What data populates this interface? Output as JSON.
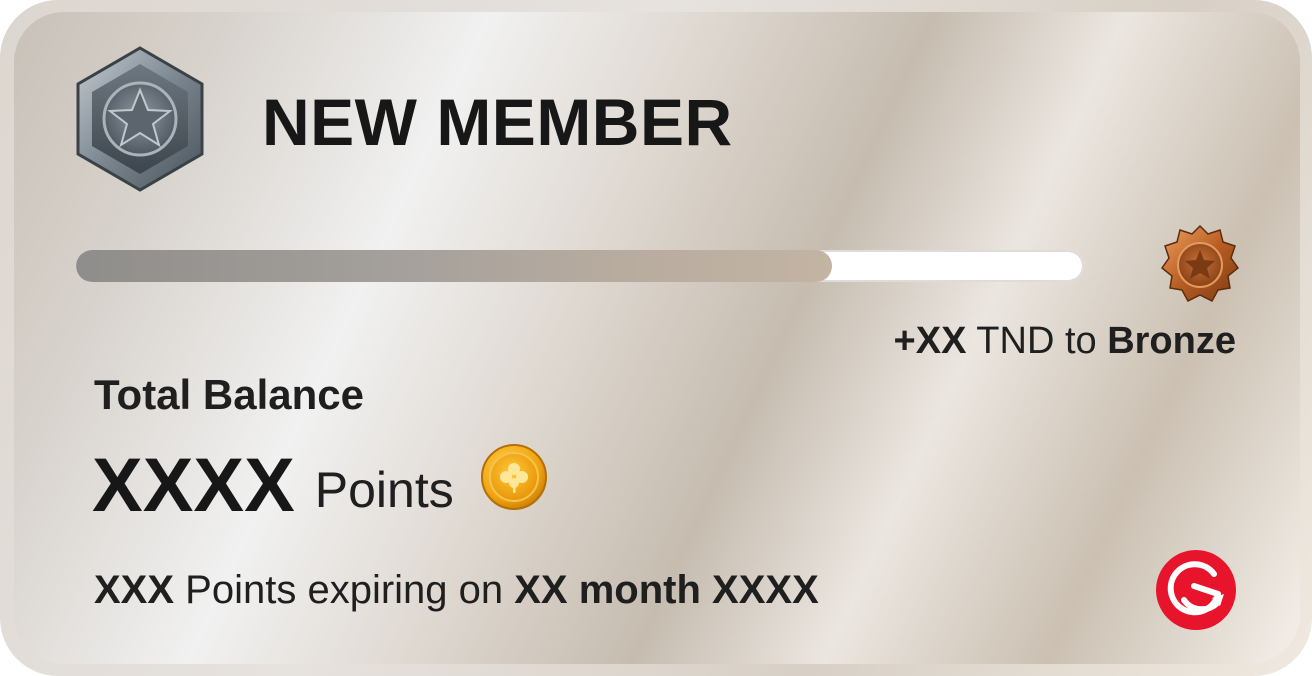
{
  "tier": {
    "title": "NEW MEMBER",
    "badge_icon": "silver-star-hexagon-badge"
  },
  "progress": {
    "fraction": 0.75,
    "fill_color": "#9f9a95",
    "track_color": "#ffffff"
  },
  "next_tier": {
    "amount": "+XX",
    "currency_text": " TND to ",
    "tier_name": "Bronze",
    "badge_icon": "bronze-star-badge"
  },
  "balance": {
    "label": "Total Balance",
    "value": "XXXX",
    "unit": "Points",
    "coin_icon": "gold-clover-coin"
  },
  "expiry": {
    "points": "XXX",
    "middle_text": " Points expiring on ",
    "date": "XX month XXXX"
  },
  "brand": {
    "logo_icon": "red-circle-logo",
    "accent": "#e8142c"
  }
}
